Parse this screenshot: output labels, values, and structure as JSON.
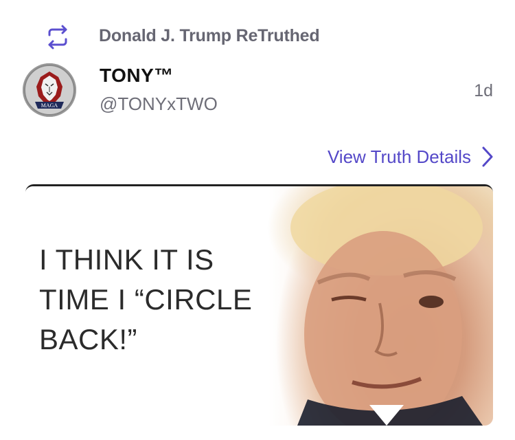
{
  "retruth": {
    "icon": "retruth-icon",
    "label": "Donald J. Trump ReTruthed"
  },
  "author": {
    "avatar_icon": "maga-lion-avatar",
    "avatar_text": "MAGA",
    "name": "TONY™",
    "handle": "@TONYxTWO"
  },
  "timestamp": "1d",
  "details_link": {
    "label": "View Truth Details",
    "icon": "chevron-right-icon"
  },
  "media": {
    "caption": "I THINK IT IS\nTIME I “CIRCLE\nBACK!”"
  },
  "colors": {
    "accent": "#5448c8",
    "muted_text": "#6e6e78",
    "primary_text": "#111111"
  }
}
